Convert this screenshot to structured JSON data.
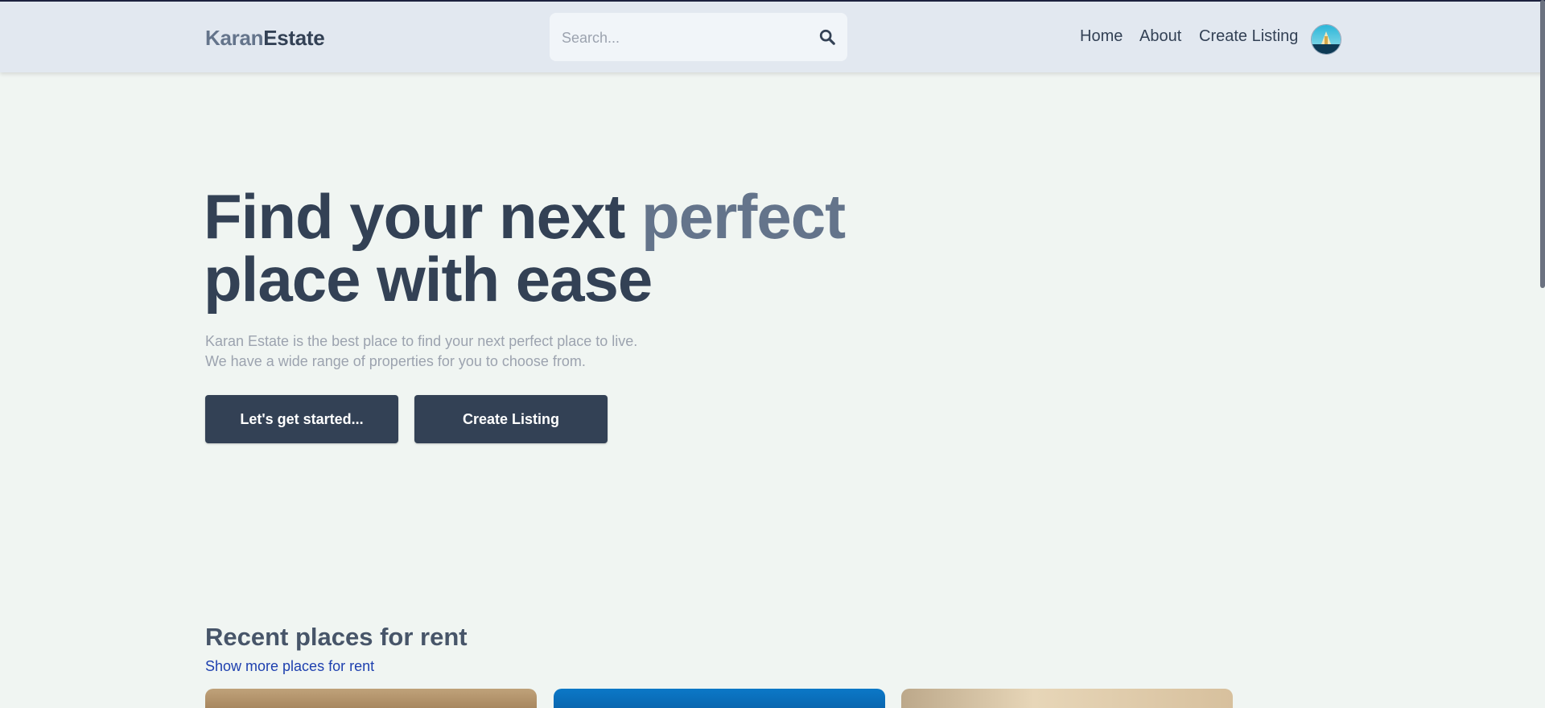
{
  "header": {
    "logo_part1": "Karan",
    "logo_part2": "Estate",
    "search_placeholder": "Search...",
    "nav": {
      "home": "Home",
      "about": "About",
      "create_listing": "Create Listing"
    }
  },
  "hero": {
    "title_line1_start": "Find your next ",
    "title_accent": "perfect",
    "title_line2": "place with ease",
    "desc_line1": "Karan Estate is the best place to find your next perfect place to live.",
    "desc_line2": "We have a wide range of properties for you to choose from.",
    "btn_start": "Let's get started...",
    "btn_create": "Create Listing"
  },
  "recent": {
    "title": "Recent places for rent",
    "link": "Show more places for rent"
  },
  "colors": {
    "navbar_bg": "#e2e8f0",
    "page_bg": "#f0f5f2",
    "primary_dark": "#334155",
    "accent_slate": "#64748b",
    "link_blue": "#1e40af"
  },
  "icons": [
    "search-icon",
    "avatar"
  ]
}
